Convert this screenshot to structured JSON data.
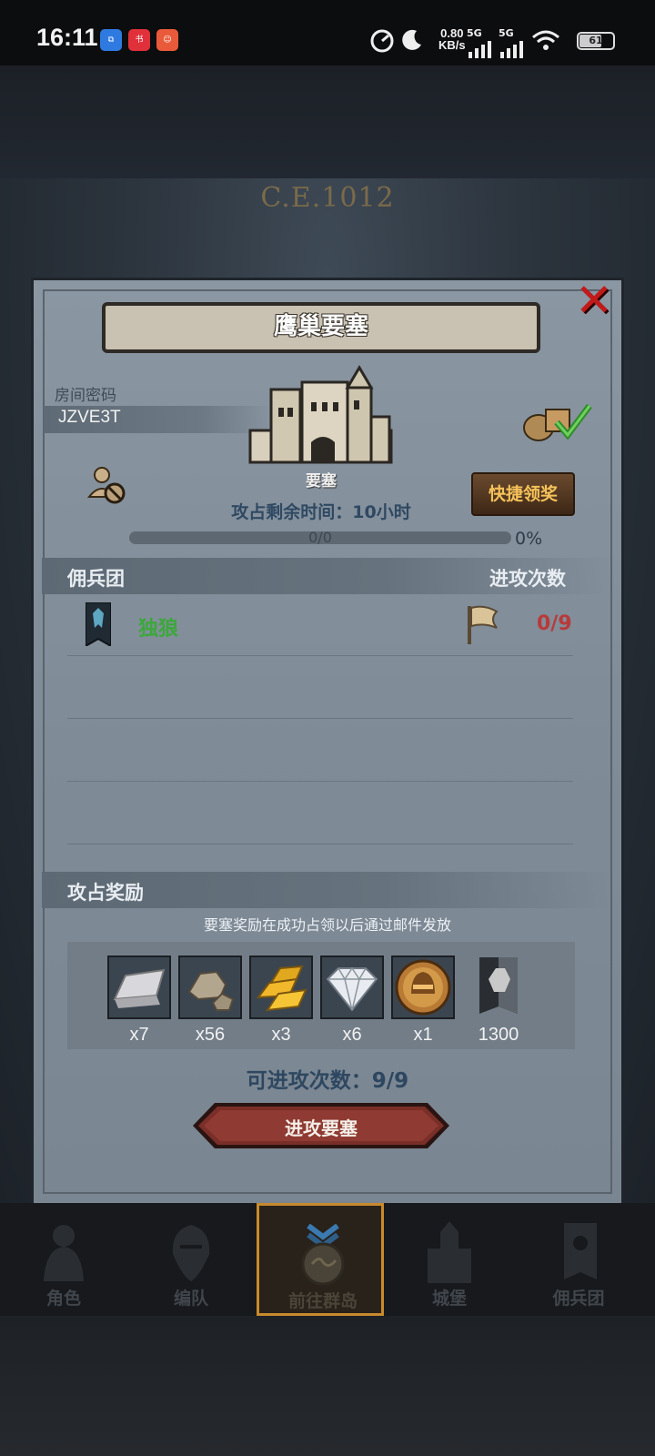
{
  "status_bar": {
    "time": "16:11",
    "net_speed_value": "0.80",
    "net_speed_unit": "KB/s",
    "signal1": "5G",
    "signal2": "5G",
    "battery": "61"
  },
  "background": {
    "era": "C.E.1012"
  },
  "dialog": {
    "title": "鹰巢要塞",
    "room_label": "房间密码",
    "room_code": "JZVE3T",
    "castle_label": "要塞",
    "quick_claim_label": "快捷领奖",
    "remaining_time": "攻占剩余时间：10小时",
    "progress_text": "0/0",
    "progress_percent": "0%",
    "mercenary_header": "佣兵团",
    "attack_count_header": "进攻次数",
    "guilds": [
      {
        "name": "独狼",
        "attacks": "0/9"
      }
    ],
    "reward_header": "攻占奖励",
    "reward_note": "要塞奖励在成功占领以后通过邮件发放",
    "rewards": [
      {
        "icon": "silver-ingot-icon",
        "qty": "x7"
      },
      {
        "icon": "ore-icon",
        "qty": "x56"
      },
      {
        "icon": "gold-bars-icon",
        "qty": "x3"
      },
      {
        "icon": "diamond-icon",
        "qty": "x6"
      },
      {
        "icon": "helmet-coin-icon",
        "qty": "x1"
      },
      {
        "icon": "mercenary-banner-icon",
        "qty": "1300"
      }
    ],
    "attempts_text": "可进攻次数：9/9",
    "attack_button_label": "进攻要塞"
  },
  "nav": [
    {
      "label": "角色",
      "icon": "character-icon",
      "active": false
    },
    {
      "label": "编队",
      "icon": "formation-icon",
      "active": false
    },
    {
      "label": "前往群岛",
      "icon": "archipelago-icon",
      "active": true
    },
    {
      "label": "城堡",
      "icon": "castle-icon",
      "active": false
    },
    {
      "label": "佣兵团",
      "icon": "mercenary-icon",
      "active": false
    }
  ],
  "colors": {
    "accent_gold": "#f5c25a",
    "guild_green": "#3ba83a",
    "attack_red": "#b83a3a",
    "close_red": "#c21a1a"
  }
}
